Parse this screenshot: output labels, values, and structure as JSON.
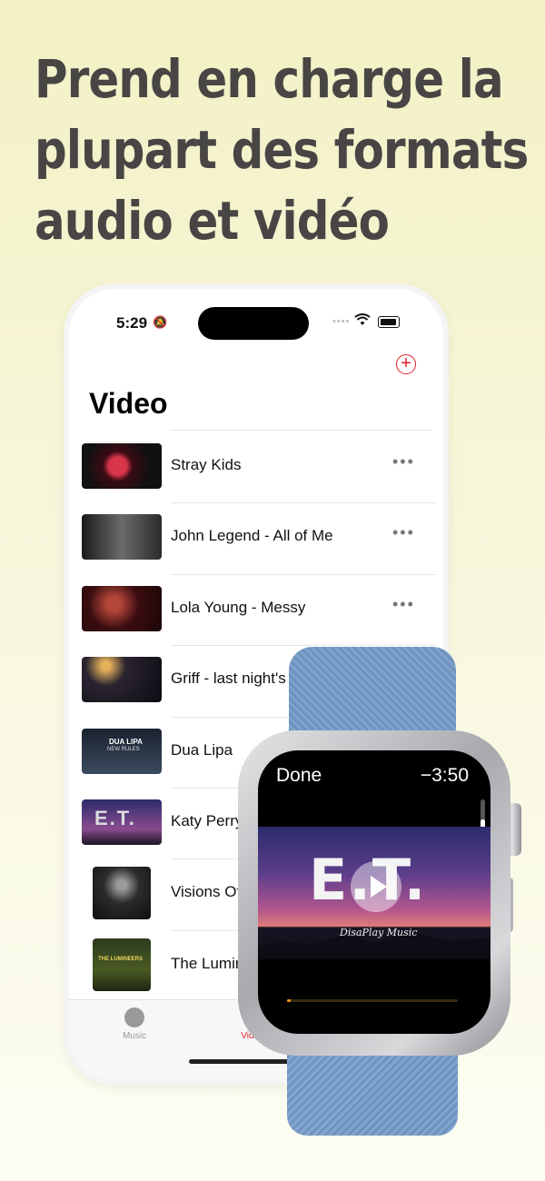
{
  "headline": {
    "line1": "Prend en charge la",
    "line2": "plupart des formats",
    "line3": "audio et vidéo"
  },
  "phone": {
    "status": {
      "time": "5:29"
    },
    "title": "Video",
    "items": [
      {
        "label": "Stray Kids"
      },
      {
        "label": "John Legend - All of Me"
      },
      {
        "label": "Lola Young - Messy"
      },
      {
        "label": "Griff - last night's"
      },
      {
        "label": "Dua Lipa"
      },
      {
        "label": "Katy Perry"
      },
      {
        "label": "Visions Of"
      },
      {
        "label": "The Lumin"
      }
    ],
    "more_label": "•••",
    "thumb_texts": {
      "dua": "DUA LIPA",
      "dua_sub": "NEW RULES",
      "et": "E.T.",
      "lumineers": "THE LUMINEERS"
    },
    "tabs": {
      "music": "Music",
      "video": "Video"
    }
  },
  "watch": {
    "done_label": "Done",
    "remaining": "−3:50",
    "now_playing_text": "E.T.",
    "watermark": "DisaPlay Music",
    "progress": 0.02
  },
  "colors": {
    "accent": "#e4202a",
    "headline": "#484545",
    "band": "#7a9dc6"
  }
}
